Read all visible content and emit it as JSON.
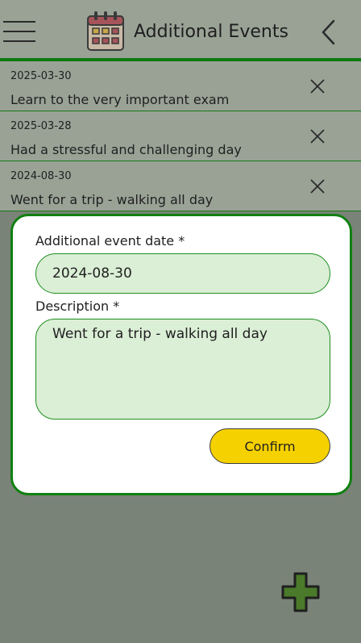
{
  "header": {
    "title": "Additional Events",
    "menu_icon": "hamburger-menu-icon",
    "app_icon": "calendar-icon",
    "back_icon": "chevron-left-icon"
  },
  "events": [
    {
      "date": "2025-03-30",
      "description": "Learn to the very important exam"
    },
    {
      "date": "2025-03-28",
      "description": "Had a stressful and challenging day"
    },
    {
      "date": "2024-08-30",
      "description": "Went for a trip - walking all day"
    }
  ],
  "dialog": {
    "date_label": "Additional event date *",
    "date_value": "2024-08-30",
    "description_label": "Description *",
    "description_value": "Went for a trip - walking all day",
    "confirm_label": "Confirm"
  },
  "colors": {
    "accent_green": "#108010",
    "field_bg": "#dbeed6",
    "confirm_yellow": "#f5d100",
    "overlay": "#7a8377"
  },
  "fab": {
    "icon": "plus-icon"
  }
}
